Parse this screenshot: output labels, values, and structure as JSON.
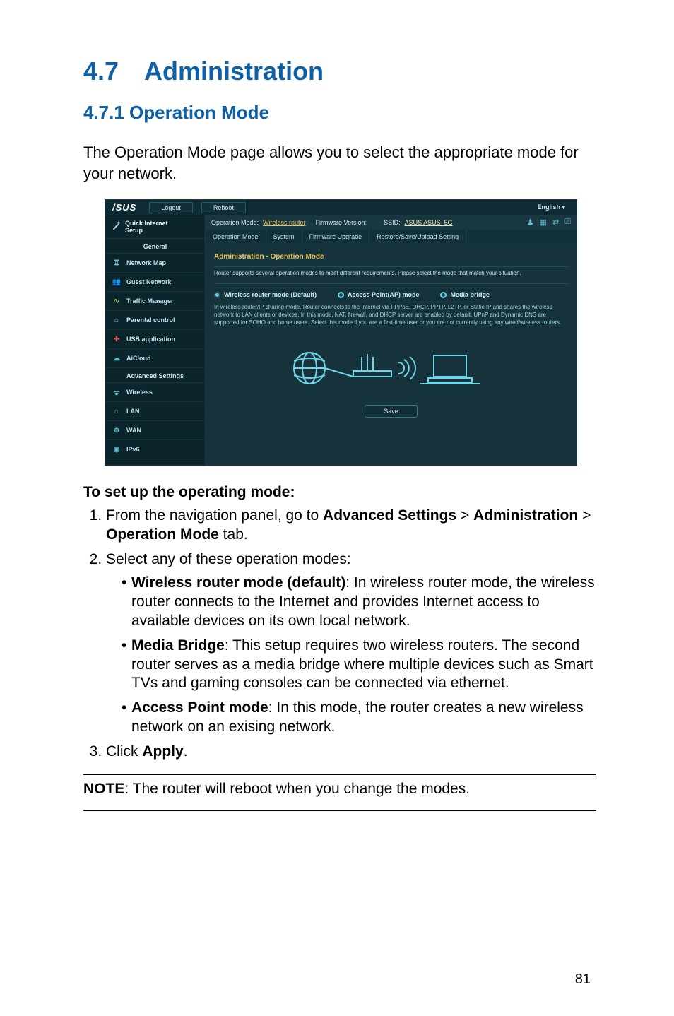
{
  "sectionTitle": "4.7 Administration",
  "subsectionTitle": "4.7.1 Operation Mode",
  "intro": "The Operation Mode page allows you to select the appropriate mode for your network.",
  "pageNumber": "81",
  "setup": {
    "heading": "To set up the operating mode:",
    "step1_a": "From the navigation panel, go to ",
    "step1_b": "Advanced Settings",
    "step1_c": " > ",
    "step1_d": "Administration",
    "step1_e": " > ",
    "step1_f": "Operation Mode",
    "step1_g": " tab.",
    "step2": "Select any of these operation modes:",
    "mode_wr_t": "Wireless router mode (default)",
    "mode_wr_b": ": In wireless router mode, the wireless router connects to the Internet and provides Internet access to available devices on its own local network.",
    "mode_mb_t": "Media Bridge",
    "mode_mb_b": ": This setup requires two wireless routers. The second router serves as a media bridge where multiple devices such as Smart TVs and gaming consoles can be connected via ethernet.",
    "mode_ap_t": "Access Point mode",
    "mode_ap_b": ": In this mode, the router creates a new wireless network on an exising network.",
    "step3_a": "Click ",
    "step3_b": "Apply",
    "step3_c": "."
  },
  "note_label": "NOTE",
  "note_body": ":  The router will reboot when you change the modes.",
  "shot": {
    "brand": "/SUS",
    "btnLogout": "Logout",
    "btnReboot": "Reboot",
    "lang": "English",
    "qisL1": "Quick Internet",
    "qisL2": "Setup",
    "grpGeneral": "General",
    "grpAdv": "Advanced Settings",
    "nav": {
      "netmap": "Network Map",
      "guest": "Guest Network",
      "traffic": "Traffic Manager",
      "parental": "Parental control",
      "usb": "USB application",
      "aicloud": "AiCloud",
      "wireless": "Wireless",
      "lan": "LAN",
      "wan": "WAN",
      "ipv6": "IPv6"
    },
    "info": {
      "opmodeLabel": "Operation Mode:",
      "opmodeVal": "Wireless router",
      "fwLabel": "Firmware Version:",
      "ssidLabel": "SSID:",
      "ssidVal": "ASUS  ASUS_5G"
    },
    "tabs": {
      "t1": "Operation Mode",
      "t2": "System",
      "t3": "Firmware Upgrade",
      "t4": "Restore/Save/Upload Setting"
    },
    "panelTitle": "Administration - Operation Mode",
    "panelSub": "Router supports several operation modes to meet different requirements. Please select the mode that match your situation.",
    "radio1": "Wireless router mode (Default)",
    "radio2": "Access Point(AP) mode",
    "radio3": "Media bridge",
    "desc1": "In wireless router/IP sharing mode, Router connects to the Internet via PPPoE, DHCP, PPTP, L2TP, or Static IP and shares the wireless network to LAN clients or devices. In this mode, NAT, firewall, and DHCP server are enabled by default. UPnP and Dynamic DNS are supported for SOHO and home users. Select this mode if you are a first-time user or you are not currently using any wired/wireless routers.",
    "saveBtn": "Save"
  }
}
